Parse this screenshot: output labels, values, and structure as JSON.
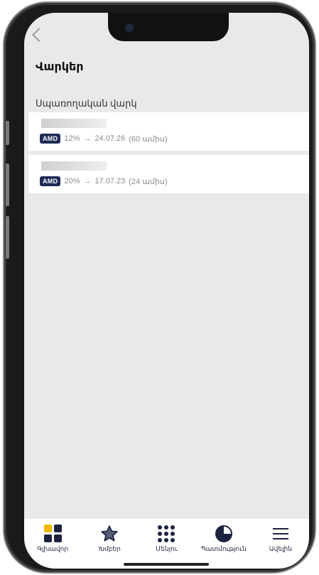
{
  "header": {
    "title": "Վարկեր"
  },
  "section": {
    "title": "Սպառողական վարկ"
  },
  "loans": [
    {
      "currency": "AMD",
      "rate": "12%",
      "arrow": "→",
      "end_date": "24.07.26",
      "term": "(60 ամիս)"
    },
    {
      "currency": "AMD",
      "rate": "20%",
      "arrow": "→",
      "end_date": "17.07.23",
      "term": "(24 ամիս)"
    }
  ],
  "tabbar": {
    "items": [
      {
        "label": "Գլխավոր",
        "icon": "home-grid-icon"
      },
      {
        "label": "Խմբեր",
        "icon": "star-icon"
      },
      {
        "label": "Մենյու",
        "icon": "dots-grid-icon"
      },
      {
        "label": "Պատմություն",
        "icon": "history-pie-icon"
      },
      {
        "label": "Ավելին",
        "icon": "menu-icon"
      }
    ]
  },
  "colors": {
    "accent": "#f2b705",
    "navy": "#1c2340",
    "badge": "#1e2a55",
    "background": "#e8e9eb"
  }
}
